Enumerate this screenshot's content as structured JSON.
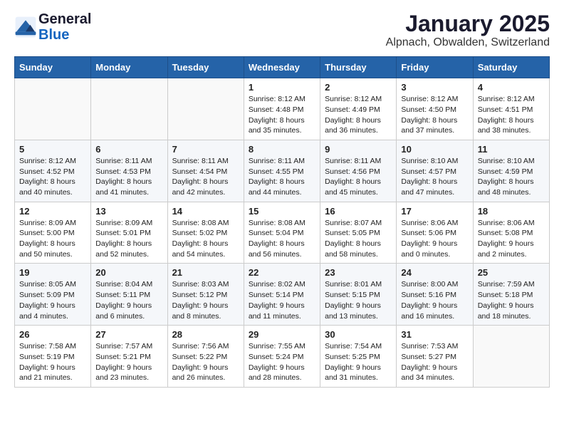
{
  "logo": {
    "general": "General",
    "blue": "Blue"
  },
  "title": "January 2025",
  "subtitle": "Alpnach, Obwalden, Switzerland",
  "days_of_week": [
    "Sunday",
    "Monday",
    "Tuesday",
    "Wednesday",
    "Thursday",
    "Friday",
    "Saturday"
  ],
  "weeks": [
    [
      {
        "day": "",
        "info": ""
      },
      {
        "day": "",
        "info": ""
      },
      {
        "day": "",
        "info": ""
      },
      {
        "day": "1",
        "info": "Sunrise: 8:12 AM\nSunset: 4:48 PM\nDaylight: 8 hours\nand 35 minutes."
      },
      {
        "day": "2",
        "info": "Sunrise: 8:12 AM\nSunset: 4:49 PM\nDaylight: 8 hours\nand 36 minutes."
      },
      {
        "day": "3",
        "info": "Sunrise: 8:12 AM\nSunset: 4:50 PM\nDaylight: 8 hours\nand 37 minutes."
      },
      {
        "day": "4",
        "info": "Sunrise: 8:12 AM\nSunset: 4:51 PM\nDaylight: 8 hours\nand 38 minutes."
      }
    ],
    [
      {
        "day": "5",
        "info": "Sunrise: 8:12 AM\nSunset: 4:52 PM\nDaylight: 8 hours\nand 40 minutes."
      },
      {
        "day": "6",
        "info": "Sunrise: 8:11 AM\nSunset: 4:53 PM\nDaylight: 8 hours\nand 41 minutes."
      },
      {
        "day": "7",
        "info": "Sunrise: 8:11 AM\nSunset: 4:54 PM\nDaylight: 8 hours\nand 42 minutes."
      },
      {
        "day": "8",
        "info": "Sunrise: 8:11 AM\nSunset: 4:55 PM\nDaylight: 8 hours\nand 44 minutes."
      },
      {
        "day": "9",
        "info": "Sunrise: 8:11 AM\nSunset: 4:56 PM\nDaylight: 8 hours\nand 45 minutes."
      },
      {
        "day": "10",
        "info": "Sunrise: 8:10 AM\nSunset: 4:57 PM\nDaylight: 8 hours\nand 47 minutes."
      },
      {
        "day": "11",
        "info": "Sunrise: 8:10 AM\nSunset: 4:59 PM\nDaylight: 8 hours\nand 48 minutes."
      }
    ],
    [
      {
        "day": "12",
        "info": "Sunrise: 8:09 AM\nSunset: 5:00 PM\nDaylight: 8 hours\nand 50 minutes."
      },
      {
        "day": "13",
        "info": "Sunrise: 8:09 AM\nSunset: 5:01 PM\nDaylight: 8 hours\nand 52 minutes."
      },
      {
        "day": "14",
        "info": "Sunrise: 8:08 AM\nSunset: 5:02 PM\nDaylight: 8 hours\nand 54 minutes."
      },
      {
        "day": "15",
        "info": "Sunrise: 8:08 AM\nSunset: 5:04 PM\nDaylight: 8 hours\nand 56 minutes."
      },
      {
        "day": "16",
        "info": "Sunrise: 8:07 AM\nSunset: 5:05 PM\nDaylight: 8 hours\nand 58 minutes."
      },
      {
        "day": "17",
        "info": "Sunrise: 8:06 AM\nSunset: 5:06 PM\nDaylight: 9 hours\nand 0 minutes."
      },
      {
        "day": "18",
        "info": "Sunrise: 8:06 AM\nSunset: 5:08 PM\nDaylight: 9 hours\nand 2 minutes."
      }
    ],
    [
      {
        "day": "19",
        "info": "Sunrise: 8:05 AM\nSunset: 5:09 PM\nDaylight: 9 hours\nand 4 minutes."
      },
      {
        "day": "20",
        "info": "Sunrise: 8:04 AM\nSunset: 5:11 PM\nDaylight: 9 hours\nand 6 minutes."
      },
      {
        "day": "21",
        "info": "Sunrise: 8:03 AM\nSunset: 5:12 PM\nDaylight: 9 hours\nand 8 minutes."
      },
      {
        "day": "22",
        "info": "Sunrise: 8:02 AM\nSunset: 5:14 PM\nDaylight: 9 hours\nand 11 minutes."
      },
      {
        "day": "23",
        "info": "Sunrise: 8:01 AM\nSunset: 5:15 PM\nDaylight: 9 hours\nand 13 minutes."
      },
      {
        "day": "24",
        "info": "Sunrise: 8:00 AM\nSunset: 5:16 PM\nDaylight: 9 hours\nand 16 minutes."
      },
      {
        "day": "25",
        "info": "Sunrise: 7:59 AM\nSunset: 5:18 PM\nDaylight: 9 hours\nand 18 minutes."
      }
    ],
    [
      {
        "day": "26",
        "info": "Sunrise: 7:58 AM\nSunset: 5:19 PM\nDaylight: 9 hours\nand 21 minutes."
      },
      {
        "day": "27",
        "info": "Sunrise: 7:57 AM\nSunset: 5:21 PM\nDaylight: 9 hours\nand 23 minutes."
      },
      {
        "day": "28",
        "info": "Sunrise: 7:56 AM\nSunset: 5:22 PM\nDaylight: 9 hours\nand 26 minutes."
      },
      {
        "day": "29",
        "info": "Sunrise: 7:55 AM\nSunset: 5:24 PM\nDaylight: 9 hours\nand 28 minutes."
      },
      {
        "day": "30",
        "info": "Sunrise: 7:54 AM\nSunset: 5:25 PM\nDaylight: 9 hours\nand 31 minutes."
      },
      {
        "day": "31",
        "info": "Sunrise: 7:53 AM\nSunset: 5:27 PM\nDaylight: 9 hours\nand 34 minutes."
      },
      {
        "day": "",
        "info": ""
      }
    ]
  ]
}
